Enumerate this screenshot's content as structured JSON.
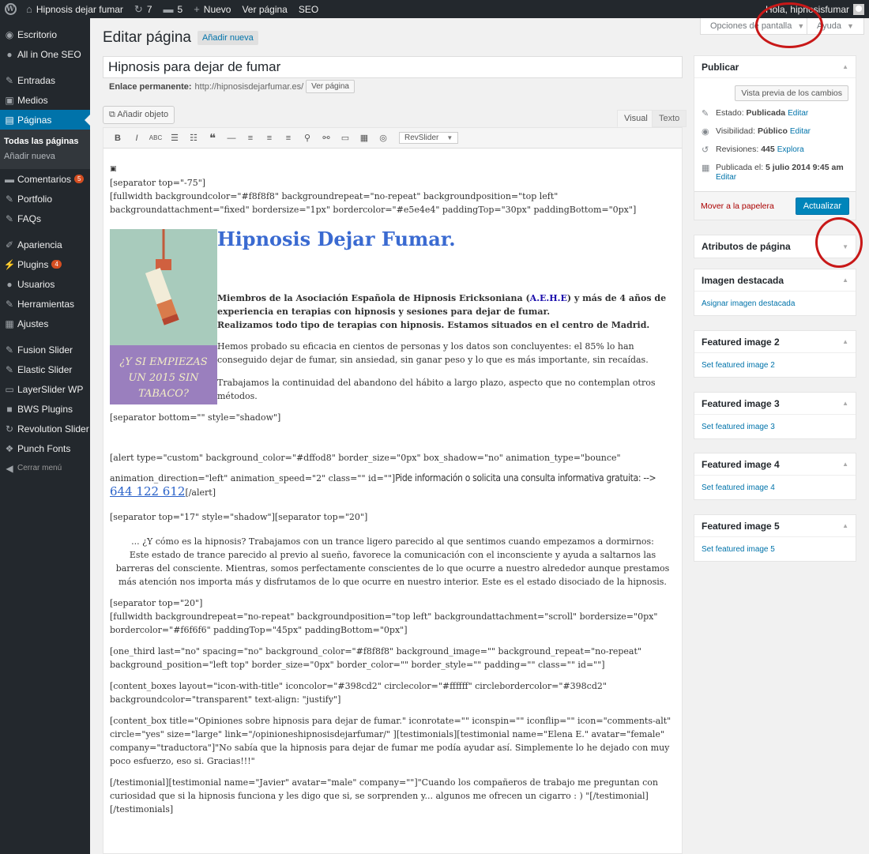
{
  "adminbar": {
    "site_name": "Hipnosis dejar fumar",
    "updates_count": "7",
    "comments_count": "5",
    "new_label": "Nuevo",
    "view_page": "Ver página",
    "seo": "SEO",
    "greeting": "Hola, hipnosisfumar"
  },
  "sidebar": {
    "items": [
      {
        "label": "Escritorio"
      },
      {
        "label": "All in One SEO"
      },
      {
        "label": "Entradas"
      },
      {
        "label": "Medios"
      },
      {
        "label": "Páginas"
      },
      {
        "label": "Comentarios",
        "badge": "5"
      },
      {
        "label": "Portfolio"
      },
      {
        "label": "FAQs"
      },
      {
        "label": "Apariencia"
      },
      {
        "label": "Plugins",
        "badge": "4"
      },
      {
        "label": "Usuarios"
      },
      {
        "label": "Herramientas"
      },
      {
        "label": "Ajustes"
      },
      {
        "label": "Fusion Slider"
      },
      {
        "label": "Elastic Slider"
      },
      {
        "label": "LayerSlider WP"
      },
      {
        "label": "BWS Plugins"
      },
      {
        "label": "Revolution Slider"
      },
      {
        "label": "Punch Fonts"
      },
      {
        "label": "Cerrar menú"
      }
    ],
    "submenu": [
      "Todas las páginas",
      "Añadir nueva"
    ]
  },
  "header": {
    "title": "Editar página",
    "add_new": "Añadir nueva",
    "screen_options": "Opciones de pantalla",
    "help": "Ayuda"
  },
  "post": {
    "title": "Hipnosis para dejar de fumar",
    "permalink_label": "Enlace permanente:",
    "permalink_url": "http://hipnosisdejarfumar.es/",
    "view_page_btn": "Ver página",
    "add_media": "Añadir objeto",
    "tab_visual": "Visual",
    "tab_text": "Texto",
    "revslider": "RevSlider"
  },
  "content": {
    "icon_placeholder": "▣",
    "line1": "[separator top=\"-75\"]",
    "line2": "[fullwidth backgroundcolor=\"#f8f8f8\" backgroundrepeat=\"no-repeat\" backgroundposition=\"top left\" backgroundattachment=\"fixed\" bordersize=\"1px\" bordercolor=\"#e5e4e4\" paddingTop=\"30px\" paddingBottom=\"0px\"]",
    "image_text": "¿Y SI EMPIEZAS UN 2015 SIN TABACO?",
    "hero_title": "Hipnosis Dejar Fumar.",
    "hero_bold1": "Miembros de la Asociación Española de Hipnosis Ericksoniana (",
    "hero_link": "A.E.H.E",
    "hero_bold2": ") y más de 4 años de experiencia en terapias con hipnosis y sesiones para dejar de fumar.",
    "hero_bold3": "Realizamos todo tipo de terapias con hipnosis. Estamos situados en el centro de Madrid.",
    "hero_p1": "Hemos probado su eficacia en cientos de personas y los datos son concluyentes: el 85% lo han conseguido dejar de fumar, sin ansiedad, sin ganar peso y lo que es más importante, sin recaídas.",
    "hero_p2": "Trabajamos la continuidad del abandono del hábito a largo plazo, aspecto que no contemplan otros métodos.",
    "sep_shadow": "[separator bottom=\"\" style=\"shadow\"]",
    "alert1": "[alert type=\"custom\" background_color=\"#dffod8\" border_size=\"0px\" box_shadow=\"no\" animation_type=\"bounce\"",
    "alert2": "animation_direction=\"left\" animation_speed=\"2\" class=\"\" id=\"\"]",
    "alert_hand": "Pide información o solicita una consulta informativa gratuita: -->",
    "alert_phone": "644 122 612",
    "alert_end": "[/alert]",
    "sep2": "[separator top=\"17\" style=\"shadow\"][separator top=\"20\"]",
    "center1": "... ¿Y cómo es la hipnosis? Trabajamos con un trance ligero parecido al que sentimos cuando empezamos a dormirnos:",
    "center2": "Este estado de trance parecido al previo al sueño, favorece la comunicación con el inconsciente y ayuda a saltarnos las barreras del consciente. Mientras, somos perfectamente conscientes de lo que ocurre a nuestro alrededor aunque prestamos más atención nos importa más y disfrutamos de lo que ocurre en nuestro interior. Este es el estado disociado de la hipnosis.",
    "sep3": "[separator top=\"20\"]",
    "fullwidth2": "[fullwidth backgroundrepeat=\"no-repeat\" backgroundposition=\"top left\" backgroundattachment=\"scroll\" bordersize=\"0px\" bordercolor=\"#f6f6f6\" paddingTop=\"45px\" paddingBottom=\"0px\"]",
    "one_third": "[one_third last=\"no\" spacing=\"no\" background_color=\"#f8f8f8\" background_image=\"\" background_repeat=\"no-repeat\" background_position=\"left top\" border_size=\"0px\" border_color=\"\" border_style=\"\" padding=\"\" class=\"\" id=\"\"]",
    "content_boxes": "[content_boxes layout=\"icon-with-title\" iconcolor=\"#398cd2\" circlecolor=\"#ffffff\" circlebordercolor=\"#398cd2\" backgroundcolor=\"transparent\" text-align: \"justify\"]",
    "content_box": "[content_box title=\"Opiniones sobre hipnosis para dejar de fumar.\" iconrotate=\"\" iconspin=\"\" iconflip=\"\" icon=\"comments-alt\" circle=\"yes\" size=\"large\" link=\"/opinioneshipnosisdejarfumar/\" ][testimonials][testimonial name=\"Elena E.\" avatar=\"female\" company=\"traductora\"]\"No sabía que la hipnosis para dejar de fumar me podía ayudar así. Simplemente lo he dejado con muy poco esfuerzo, eso si. Gracias!!!\"",
    "testimonial2": "[/testimonial][testimonial name=\"Javier\" avatar=\"male\" company=\"\"]\"Cuando los compañeros de trabajo me preguntan con curiosidad que si la hipnosis funciona y les digo que si, se sorprenden y... algunos me ofrecen un cigarro : ) \"[/testimonial]",
    "end_testimonials": "[/testimonials]"
  },
  "publish": {
    "title": "Publicar",
    "preview_btn": "Vista previa de los cambios",
    "status_label": "Estado:",
    "status_value": "Publicada",
    "status_link": "Editar",
    "visibility_label": "Visibilidad:",
    "visibility_value": "Público",
    "visibility_link": "Editar",
    "revisions_label": "Revisiones:",
    "revisions_value": "445",
    "revisions_link": "Explora",
    "published_label": "Publicada el:",
    "published_value": "5 julio 2014 9:45 am",
    "published_link": "Editar",
    "trash": "Mover a la papelera",
    "update": "Actualizar"
  },
  "boxes": {
    "page_attributes": "Atributos de página",
    "featured": {
      "title": "Imagen destacada",
      "link": "Asignar imagen destacada"
    },
    "f2": {
      "title": "Featured image 2",
      "link": "Set featured image 2"
    },
    "f3": {
      "title": "Featured image 3",
      "link": "Set featured image 3"
    },
    "f4": {
      "title": "Featured image 4",
      "link": "Set featured image 4"
    },
    "f5": {
      "title": "Featured image 5",
      "link": "Set featured image 5"
    }
  }
}
